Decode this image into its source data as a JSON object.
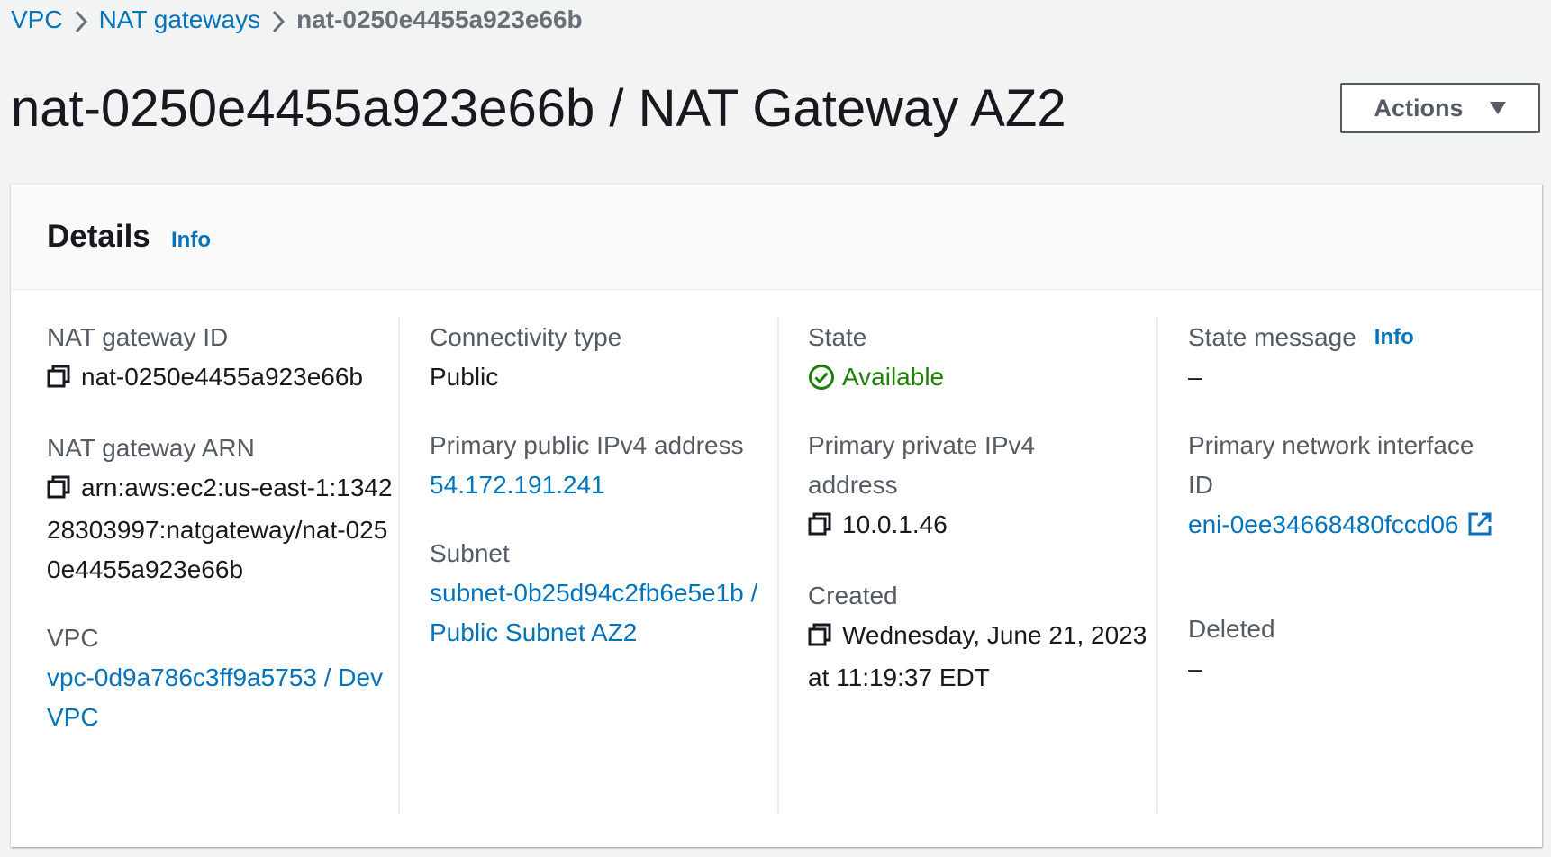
{
  "breadcrumb": {
    "vpc": "VPC",
    "nat_gateways": "NAT gateways",
    "current": "nat-0250e4455a923e66b"
  },
  "header": {
    "title": "nat-0250e4455a923e66b / NAT Gateway AZ2",
    "actions_label": "Actions"
  },
  "details": {
    "title": "Details",
    "info_label": "Info",
    "nat_gateway_id": {
      "label": "NAT gateway ID",
      "value": "nat-0250e4455a923e66b"
    },
    "nat_gateway_arn": {
      "label": "NAT gateway ARN",
      "value": "arn:aws:ec2:us-east-1:134228303997:natgateway/nat-0250e4455a923e66b"
    },
    "vpc": {
      "label": "VPC",
      "value": "vpc-0d9a786c3ff9a5753 / Dev VPC"
    },
    "connectivity_type": {
      "label": "Connectivity type",
      "value": "Public"
    },
    "primary_public_ipv4": {
      "label": "Primary public IPv4 address",
      "value": "54.172.191.241"
    },
    "subnet": {
      "label": "Subnet",
      "value": "subnet-0b25d94c2fb6e5e1b / Public Subnet AZ2"
    },
    "state": {
      "label": "State",
      "value": "Available"
    },
    "primary_private_ipv4": {
      "label": "Primary private IPv4 address",
      "value": "10.0.1.46"
    },
    "created": {
      "label": "Created",
      "value": "Wednesday, June 21, 2023 at 11:19:37 EDT"
    },
    "state_message": {
      "label": "State message",
      "info_label": "Info",
      "value": "–"
    },
    "primary_network_interface": {
      "label": "Primary network interface ID",
      "value": "eni-0ee34668480fccd06"
    },
    "deleted": {
      "label": "Deleted",
      "value": "–"
    }
  },
  "colors": {
    "link": "#0073bb",
    "success": "#1d8102",
    "text": "#16191f",
    "label": "#545b64",
    "background": "#f2f3f3"
  },
  "icons": {
    "breadcrumb_separator": "chevron-right-icon",
    "actions_caret": "caret-down-icon",
    "copy": "copy-icon",
    "status": "check-circle-icon",
    "external": "external-link-icon"
  }
}
